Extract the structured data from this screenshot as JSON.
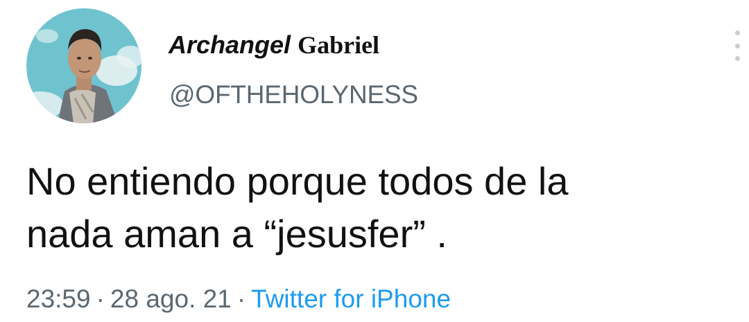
{
  "tweet": {
    "display_name_part1": "Archangel",
    "display_name_part2": "Gabriel",
    "handle": "@OFTHEHOLYNESS",
    "text_line1": "No entiendo porque todos de la",
    "text_line2": "nada aman a “jesusfer” .",
    "time": "23:59",
    "separator": "·",
    "date": "28 ago. 21",
    "source": "Twitter for iPhone"
  },
  "colors": {
    "text": "#111111",
    "muted": "#5b6770",
    "link": "#1d9bf0",
    "avatar_sky": "#6fc3cf"
  },
  "icons": {
    "avatar": "profile-photo",
    "more": "more-options-icon"
  }
}
